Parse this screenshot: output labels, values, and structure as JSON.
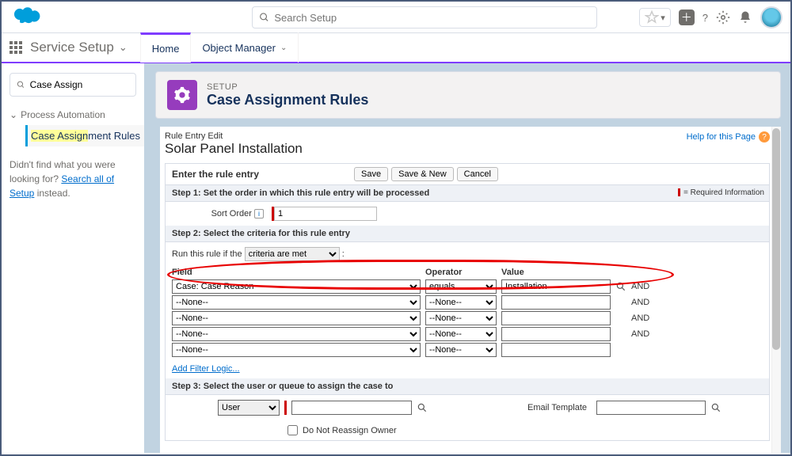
{
  "global": {
    "search_placeholder": "Search Setup",
    "app_name": "Service Setup",
    "tabs": {
      "home": "Home",
      "object_manager": "Object Manager"
    }
  },
  "sidebar": {
    "quickfind_value": "Case Assign",
    "section": "Process Automation",
    "item_prefix": "Case Assign",
    "item_suffix": "ment Rules",
    "notfound_pre": "Didn't find what you were looking for? ",
    "notfound_link": "Search all of Setup",
    "notfound_post": " instead."
  },
  "header": {
    "kicker": "SETUP",
    "title": "Case Assignment Rules"
  },
  "iframe": {
    "crumb": "Rule Entry Edit",
    "help": "Help for this Page",
    "title": "Solar Panel Installation",
    "panel_title": "Enter the rule entry",
    "buttons": {
      "save": "Save",
      "save_new": "Save & New",
      "cancel": "Cancel"
    },
    "steps": {
      "s1": "Step 1: Set the order in which this rule entry will be processed",
      "s2": "Step 2: Select the criteria for this rule entry",
      "s3": "Step 3: Select the user or queue to assign the case to"
    },
    "req_info": "= Required Information",
    "sort_order_label": "Sort Order",
    "sort_order_value": "1",
    "run_rule_label": "Run this rule if the",
    "run_rule_option": "criteria are met",
    "crit_headers": {
      "field": "Field",
      "operator": "Operator",
      "value": "Value"
    },
    "rows": [
      {
        "field": "Case: Case Reason",
        "operator": "equals",
        "value": "Installation"
      },
      {
        "field": "--None--",
        "operator": "--None--",
        "value": ""
      },
      {
        "field": "--None--",
        "operator": "--None--",
        "value": ""
      },
      {
        "field": "--None--",
        "operator": "--None--",
        "value": ""
      },
      {
        "field": "--None--",
        "operator": "--None--",
        "value": ""
      }
    ],
    "and": "AND",
    "add_logic": "Add Filter Logic...",
    "assign_option": "User",
    "reassign_label": "Do Not Reassign Owner",
    "email_template_label": "Email Template"
  }
}
